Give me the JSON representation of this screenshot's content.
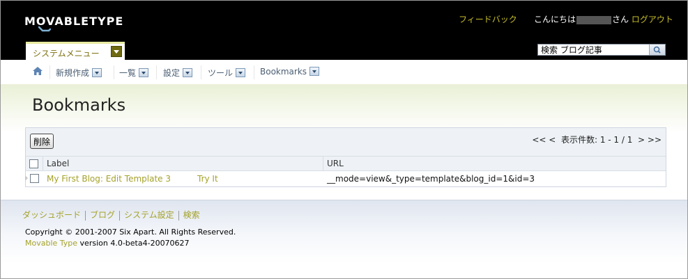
{
  "header": {
    "logo_text": "MOVABLETYPE",
    "feedback": "フィードバック",
    "greeting_prefix": "こんにちは",
    "greeting_suffix": "さん",
    "logout": "ログアウト",
    "system_menu": "システムメニュー",
    "search_value": "検索 ブログ記事"
  },
  "nav": {
    "items": [
      {
        "label": "新規作成"
      },
      {
        "label": "一覧"
      },
      {
        "label": "設定"
      },
      {
        "label": "ツール"
      },
      {
        "label": "Bookmarks"
      }
    ]
  },
  "page": {
    "title": "Bookmarks"
  },
  "table": {
    "delete_label": "削除",
    "pager_prev": "<< <",
    "pager_text": "表示件数: 1 - 1 / 1",
    "pager_next": "> >>",
    "columns": [
      "Label",
      "URL"
    ],
    "rows": [
      {
        "label": "My First Blog: Edit Template 3",
        "try": "Try It",
        "url": "__mode=view&_type=template&blog_id=1&id=3"
      }
    ]
  },
  "footer": {
    "links": [
      "ダッシュボード",
      "ブログ",
      "システム設定",
      "検索"
    ],
    "copyright": "Copyright © 2001-2007 Six Apart. All Rights Reserved.",
    "product": "Movable Type",
    "version": "version 4.0-beta4-20070627"
  },
  "colors": {
    "accent": "#c8bf2a",
    "header_bg": "#000000",
    "link": "#a4a22a"
  }
}
